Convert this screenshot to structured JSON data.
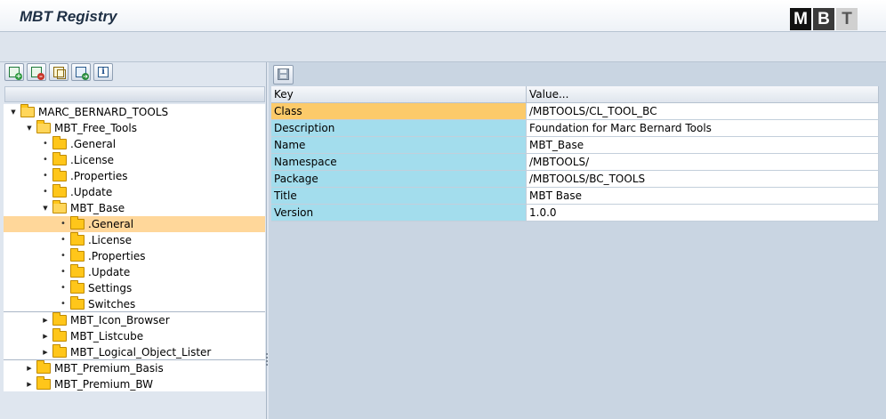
{
  "app": {
    "title": "MBT Registry",
    "logo_letters": [
      "M",
      "B",
      "T"
    ]
  },
  "left_toolbar": {
    "buttons": [
      {
        "name": "expand-node-button",
        "icon": "expand-node-icon"
      },
      {
        "name": "collapse-node-button",
        "icon": "collapse-node-icon"
      },
      {
        "name": "copy-button",
        "icon": "copy-icon"
      },
      {
        "name": "transport-button",
        "icon": "transport-icon"
      },
      {
        "name": "info-button",
        "icon": "info-icon",
        "glyph": "i"
      }
    ]
  },
  "tree": {
    "nodes": [
      {
        "label": "MARC_BERNARD_TOOLS",
        "level": 0,
        "expanded": true,
        "kind": "node"
      },
      {
        "label": "MBT_Free_Tools",
        "level": 1,
        "expanded": true,
        "kind": "node"
      },
      {
        "label": ".General",
        "level": 2,
        "kind": "leaf"
      },
      {
        "label": ".License",
        "level": 2,
        "kind": "leaf"
      },
      {
        "label": ".Properties",
        "level": 2,
        "kind": "leaf"
      },
      {
        "label": ".Update",
        "level": 2,
        "kind": "leaf"
      },
      {
        "label": "MBT_Base",
        "level": 2,
        "expanded": true,
        "kind": "node"
      },
      {
        "label": ".General",
        "level": 3,
        "kind": "leaf",
        "selected": true
      },
      {
        "label": ".License",
        "level": 3,
        "kind": "leaf"
      },
      {
        "label": ".Properties",
        "level": 3,
        "kind": "leaf"
      },
      {
        "label": ".Update",
        "level": 3,
        "kind": "leaf"
      },
      {
        "label": "Settings",
        "level": 3,
        "kind": "leaf"
      },
      {
        "label": "Switches",
        "level": 3,
        "kind": "leaf"
      },
      {
        "label": "MBT_Icon_Browser",
        "level": 2,
        "expanded": false,
        "kind": "node"
      },
      {
        "label": "MBT_Listcube",
        "level": 2,
        "expanded": false,
        "kind": "node"
      },
      {
        "label": "MBT_Logical_Object_Lister",
        "level": 2,
        "expanded": false,
        "kind": "node"
      },
      {
        "label": "MBT_Premium_Basis",
        "level": 1,
        "expanded": false,
        "kind": "node"
      },
      {
        "label": "MBT_Premium_BW",
        "level": 1,
        "expanded": false,
        "kind": "node"
      }
    ]
  },
  "grid": {
    "columns": {
      "key": "Key",
      "value": "Value..."
    },
    "rows": [
      {
        "key": "Class",
        "value": "/MBTOOLS/CL_TOOL_BC"
      },
      {
        "key": "Description",
        "value": "Foundation for Marc Bernard Tools"
      },
      {
        "key": "Name",
        "value": "MBT_Base"
      },
      {
        "key": "Namespace",
        "value": "/MBTOOLS/"
      },
      {
        "key": "Package",
        "value": "/MBTOOLS/BC_TOOLS"
      },
      {
        "key": "Title",
        "value": "MBT Base"
      },
      {
        "key": "Version",
        "value": "1.0.0"
      }
    ]
  },
  "colors": {
    "selected_node": "#ffd79a",
    "key_cell": "#a3dded",
    "key_cell_highlight": "#fcca6a",
    "folder": "#ffc61a"
  }
}
